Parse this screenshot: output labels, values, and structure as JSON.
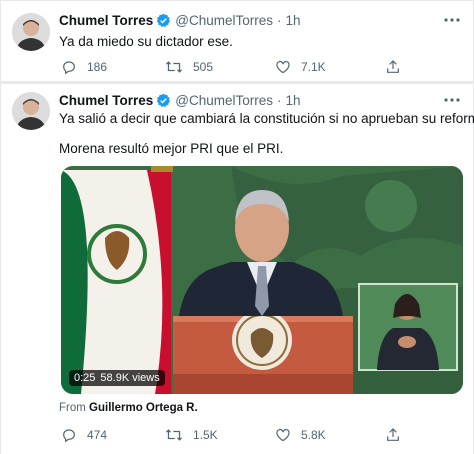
{
  "colors": {
    "verified": "#1d9bf0",
    "text_primary": "#0f1419",
    "text_secondary": "#536471",
    "background": "#e8e8e8"
  },
  "tweets": [
    {
      "name": "Chumel Torres",
      "handle": "@ChumelTorres",
      "separator": "·",
      "time": "1h",
      "text_lines": [
        "Ya da miedo su dictador ese."
      ],
      "replies": "186",
      "retweets": "505",
      "likes": "7.1K"
    },
    {
      "name": "Chumel Torres",
      "handle": "@ChumelTorres",
      "separator": "·",
      "time": "1h",
      "text_lines": [
        "Ya salió a decir que cambiará la constitución si no aprueban su reforma.",
        "Morena resultó mejor PRI que el PRI."
      ],
      "video": {
        "duration": "0:25",
        "views": "58.9K views"
      },
      "from_prefix": "From",
      "from_name": "Guillermo Ortega R.",
      "replies": "474",
      "retweets": "1.5K",
      "likes": "5.8K"
    }
  ],
  "icons": [
    "verified-badge-icon",
    "more-options-icon",
    "reply-icon",
    "retweet-icon",
    "like-icon",
    "share-icon"
  ]
}
